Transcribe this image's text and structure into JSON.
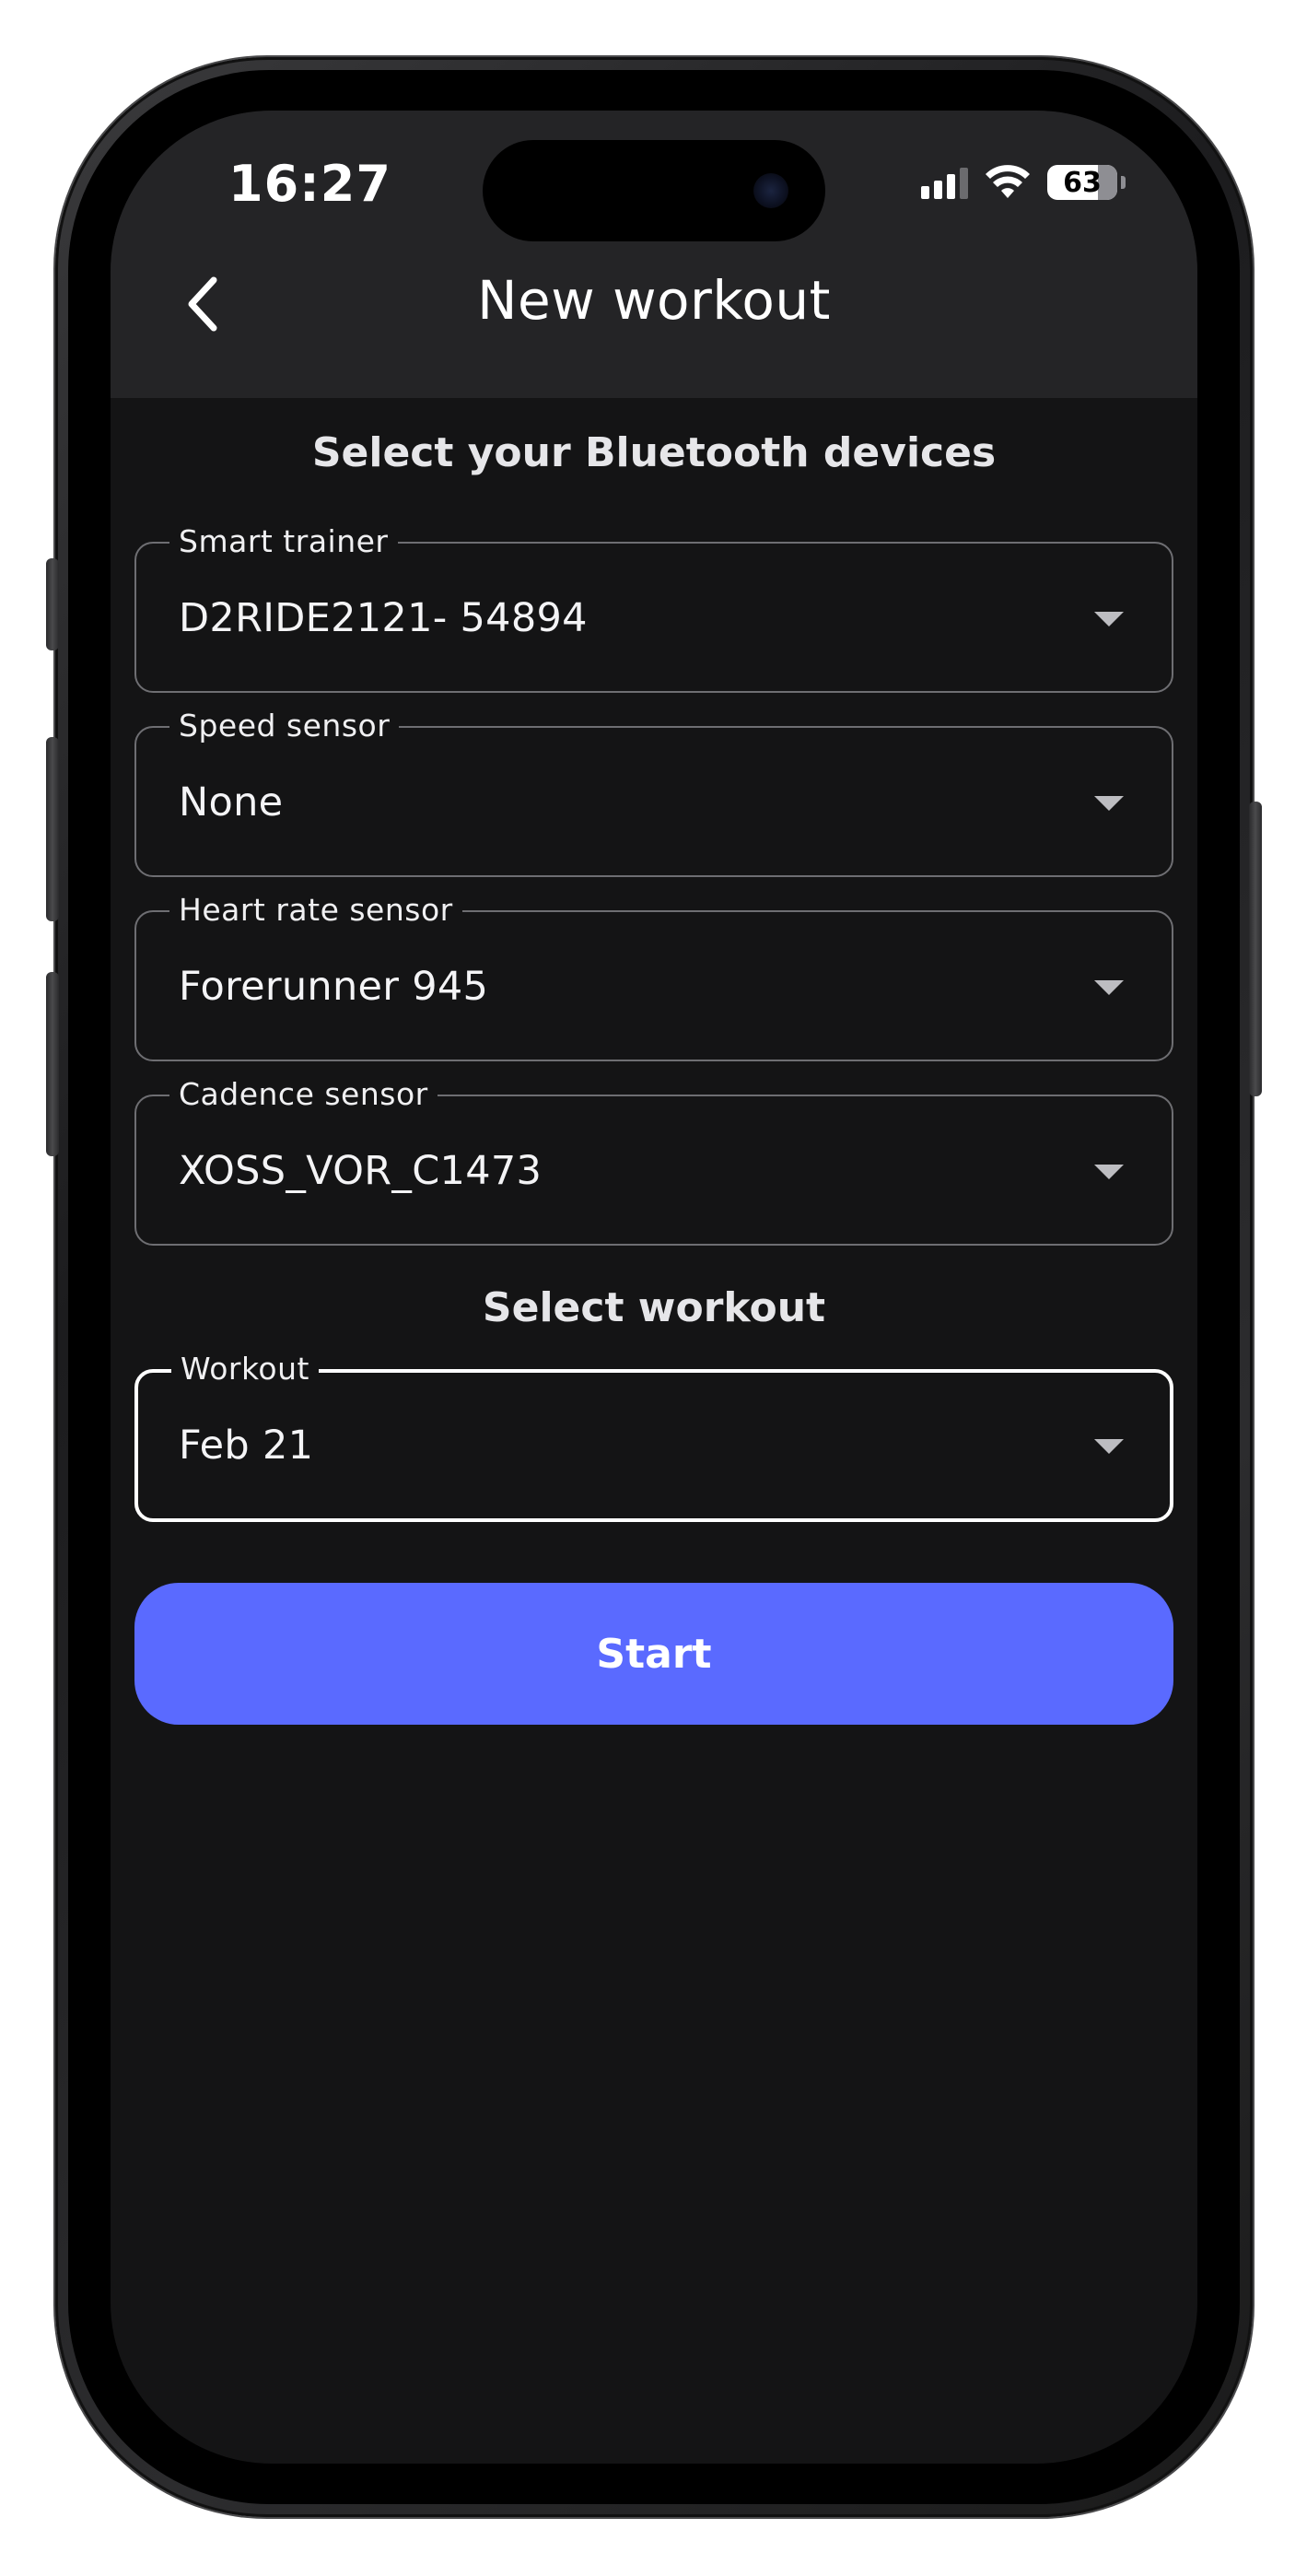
{
  "status_bar": {
    "time": "16:27",
    "battery": "63"
  },
  "header": {
    "title": "New workout",
    "back_icon": "chevron-left-icon"
  },
  "devices_section": {
    "title": "Select your Bluetooth devices",
    "fields": [
      {
        "label": "Smart trainer",
        "value": "D2RIDE2121- 54894"
      },
      {
        "label": "Speed sensor",
        "value": "None"
      },
      {
        "label": "Heart rate sensor",
        "value": "Forerunner 945"
      },
      {
        "label": "Cadence sensor",
        "value": "XOSS_VOR_C1473"
      }
    ]
  },
  "workout_section": {
    "title": "Select workout",
    "field": {
      "label": "Workout",
      "value": "Feb 21"
    }
  },
  "actions": {
    "start_label": "Start"
  },
  "colors": {
    "screen_background": "#141415",
    "header_background": "#242426",
    "accent": "#5a6aff",
    "field_border": "#6e6e72",
    "focused_border": "#ffffff"
  }
}
